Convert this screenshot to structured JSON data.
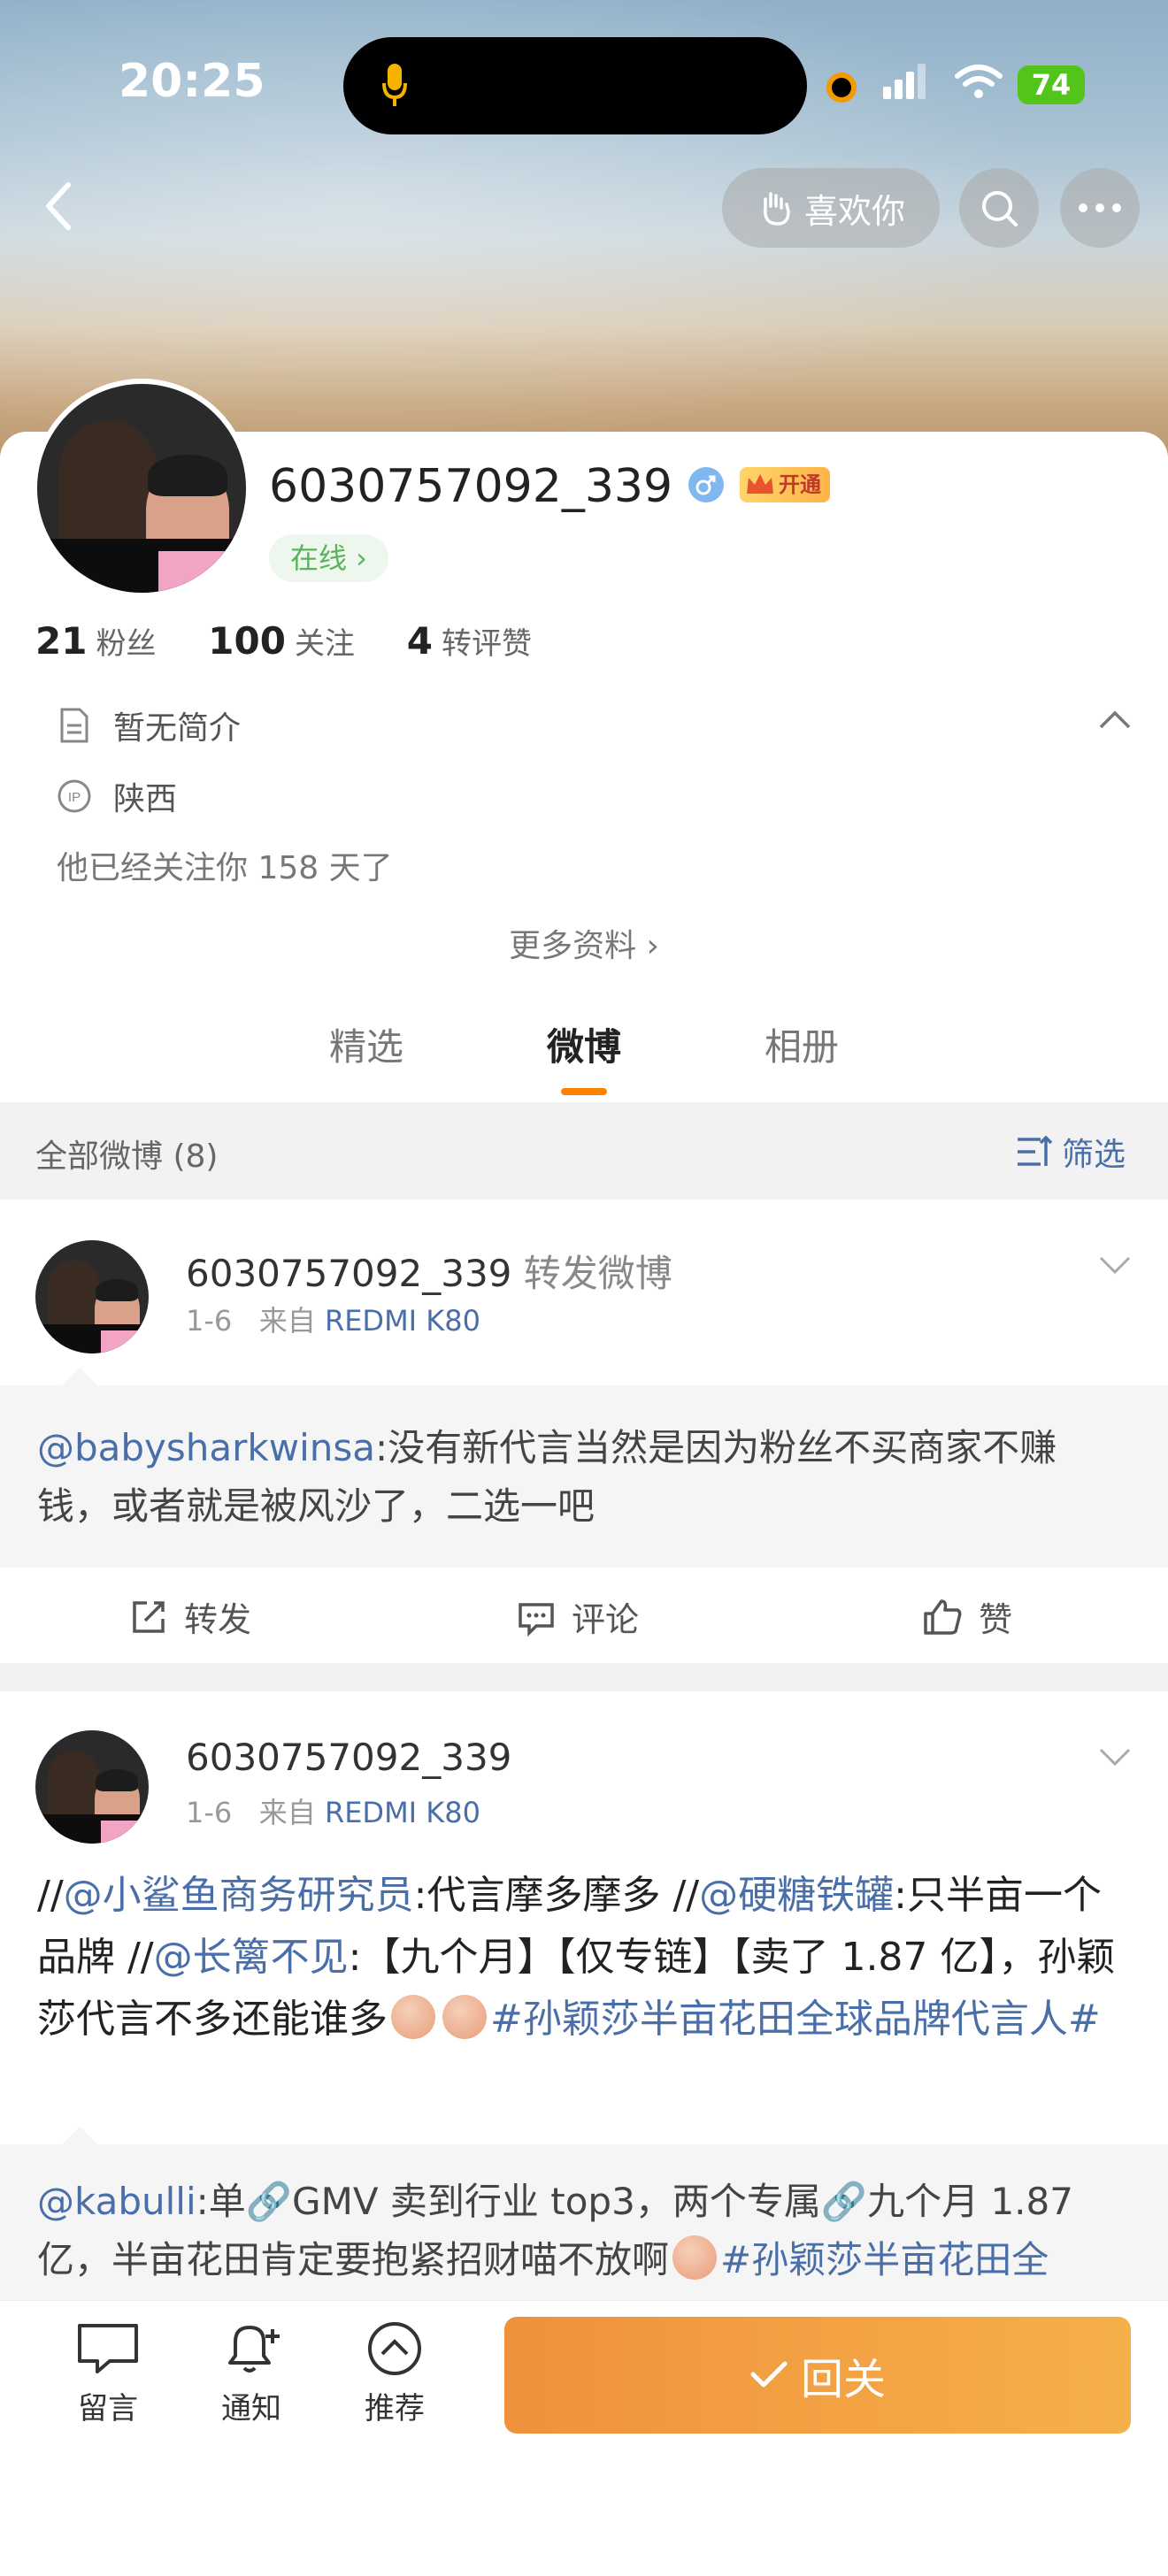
{
  "status_bar": {
    "time": "20:25",
    "battery": "74"
  },
  "header": {
    "like_label": "喜欢你"
  },
  "profile": {
    "username": "6030757092_339",
    "vip_badge": "开通",
    "online_label": "在线 ›",
    "stats": [
      {
        "num": "21",
        "label": "粉丝"
      },
      {
        "num": "100",
        "label": "关注"
      },
      {
        "num": "4",
        "label": "转评赞"
      }
    ],
    "bio": "暂无简介",
    "location": "陕西",
    "follow_days": "他已经关注你 158 天了",
    "more_info": "更多资料 ›"
  },
  "tabs": {
    "items": [
      "精选",
      "微博",
      "相册"
    ],
    "active": "微博"
  },
  "filter": {
    "label": "全部微博 (8)",
    "filter_label": "筛选"
  },
  "posts": [
    {
      "name": "6030757092_339",
      "action": "转发微博",
      "date": "1-6",
      "source_prefix": "来自",
      "device": "REDMI K80",
      "quote_user": "@babysharkwinsa",
      "quote_text": ":没有新代言当然是因为粉丝不买商家不赚钱，或者就是被风沙了，二选一吧",
      "actions": {
        "repost": "转发",
        "comment": "评论",
        "like": "赞"
      }
    },
    {
      "name": "6030757092_339",
      "date": "1-6",
      "source_prefix": "来自",
      "device": "REDMI K80",
      "body": {
        "p1": "//",
        "u1": "@小鲨鱼商务研究员",
        "p2": ":代言摩多摩多 //",
        "u2": "@硬糖铁罐",
        "p3": ":只半亩一个品牌 //",
        "u3": "@长篱不见",
        "p4": ":【九个月】【仅专链】【卖了 1.87 亿】，孙颖莎代言不多还能谁多",
        "tag": "#孙颖莎半亩花田全球品牌代言人#"
      },
      "quote_user": "@kabulli",
      "quote_text": ":单🔗GMV 卖到行业 top3，两个专属🔗九个月 1.87 亿，半亩花田肯定要抱紧招财喵不放啊",
      "quote_tag": "#孙颖莎半亩花田全"
    }
  ],
  "bottom_bar": {
    "message": "留言",
    "notify": "通知",
    "recommend": "推荐",
    "follow_back": "回关"
  },
  "colors": {
    "accent": "#ff8200",
    "link": "#4a6ea8",
    "follow_btn": "#f0913c"
  }
}
